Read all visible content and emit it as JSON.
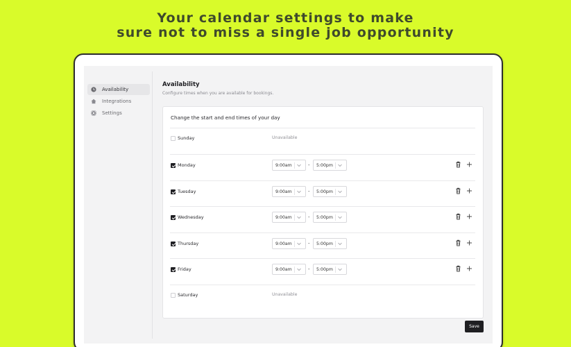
{
  "headline": {
    "line1": "Your calendar settings to make",
    "line2": "sure not to miss a single job opportunity"
  },
  "sidebar": {
    "items": [
      {
        "label": "Availability",
        "icon": "clock-icon",
        "active": true
      },
      {
        "label": "Integrations",
        "icon": "home-icon",
        "active": false
      },
      {
        "label": "Settings",
        "icon": "gear-icon",
        "active": false
      }
    ]
  },
  "main": {
    "title": "Availability",
    "subtitle": "Configure times when you are available for bookings.",
    "card_heading": "Change the start and end times of your day",
    "unavailable_label": "Unavailable",
    "days": [
      {
        "name": "Sunday",
        "available": false
      },
      {
        "name": "Monday",
        "available": true,
        "start": "9:00am",
        "end": "5:00pm"
      },
      {
        "name": "Tuesday",
        "available": true,
        "start": "9:00am",
        "end": "5:00pm"
      },
      {
        "name": "Wednesday",
        "available": true,
        "start": "9:00am",
        "end": "5:00pm"
      },
      {
        "name": "Thursday",
        "available": true,
        "start": "9:00am",
        "end": "5:00pm"
      },
      {
        "name": "Friday",
        "available": true,
        "start": "9:00am",
        "end": "5:00pm"
      },
      {
        "name": "Saturday",
        "available": false
      }
    ],
    "range_separator": "-",
    "save_label": "Save"
  },
  "colors": {
    "background": "#d9fb2a",
    "headline": "#3f4a2c",
    "button": "#1f1f22"
  }
}
